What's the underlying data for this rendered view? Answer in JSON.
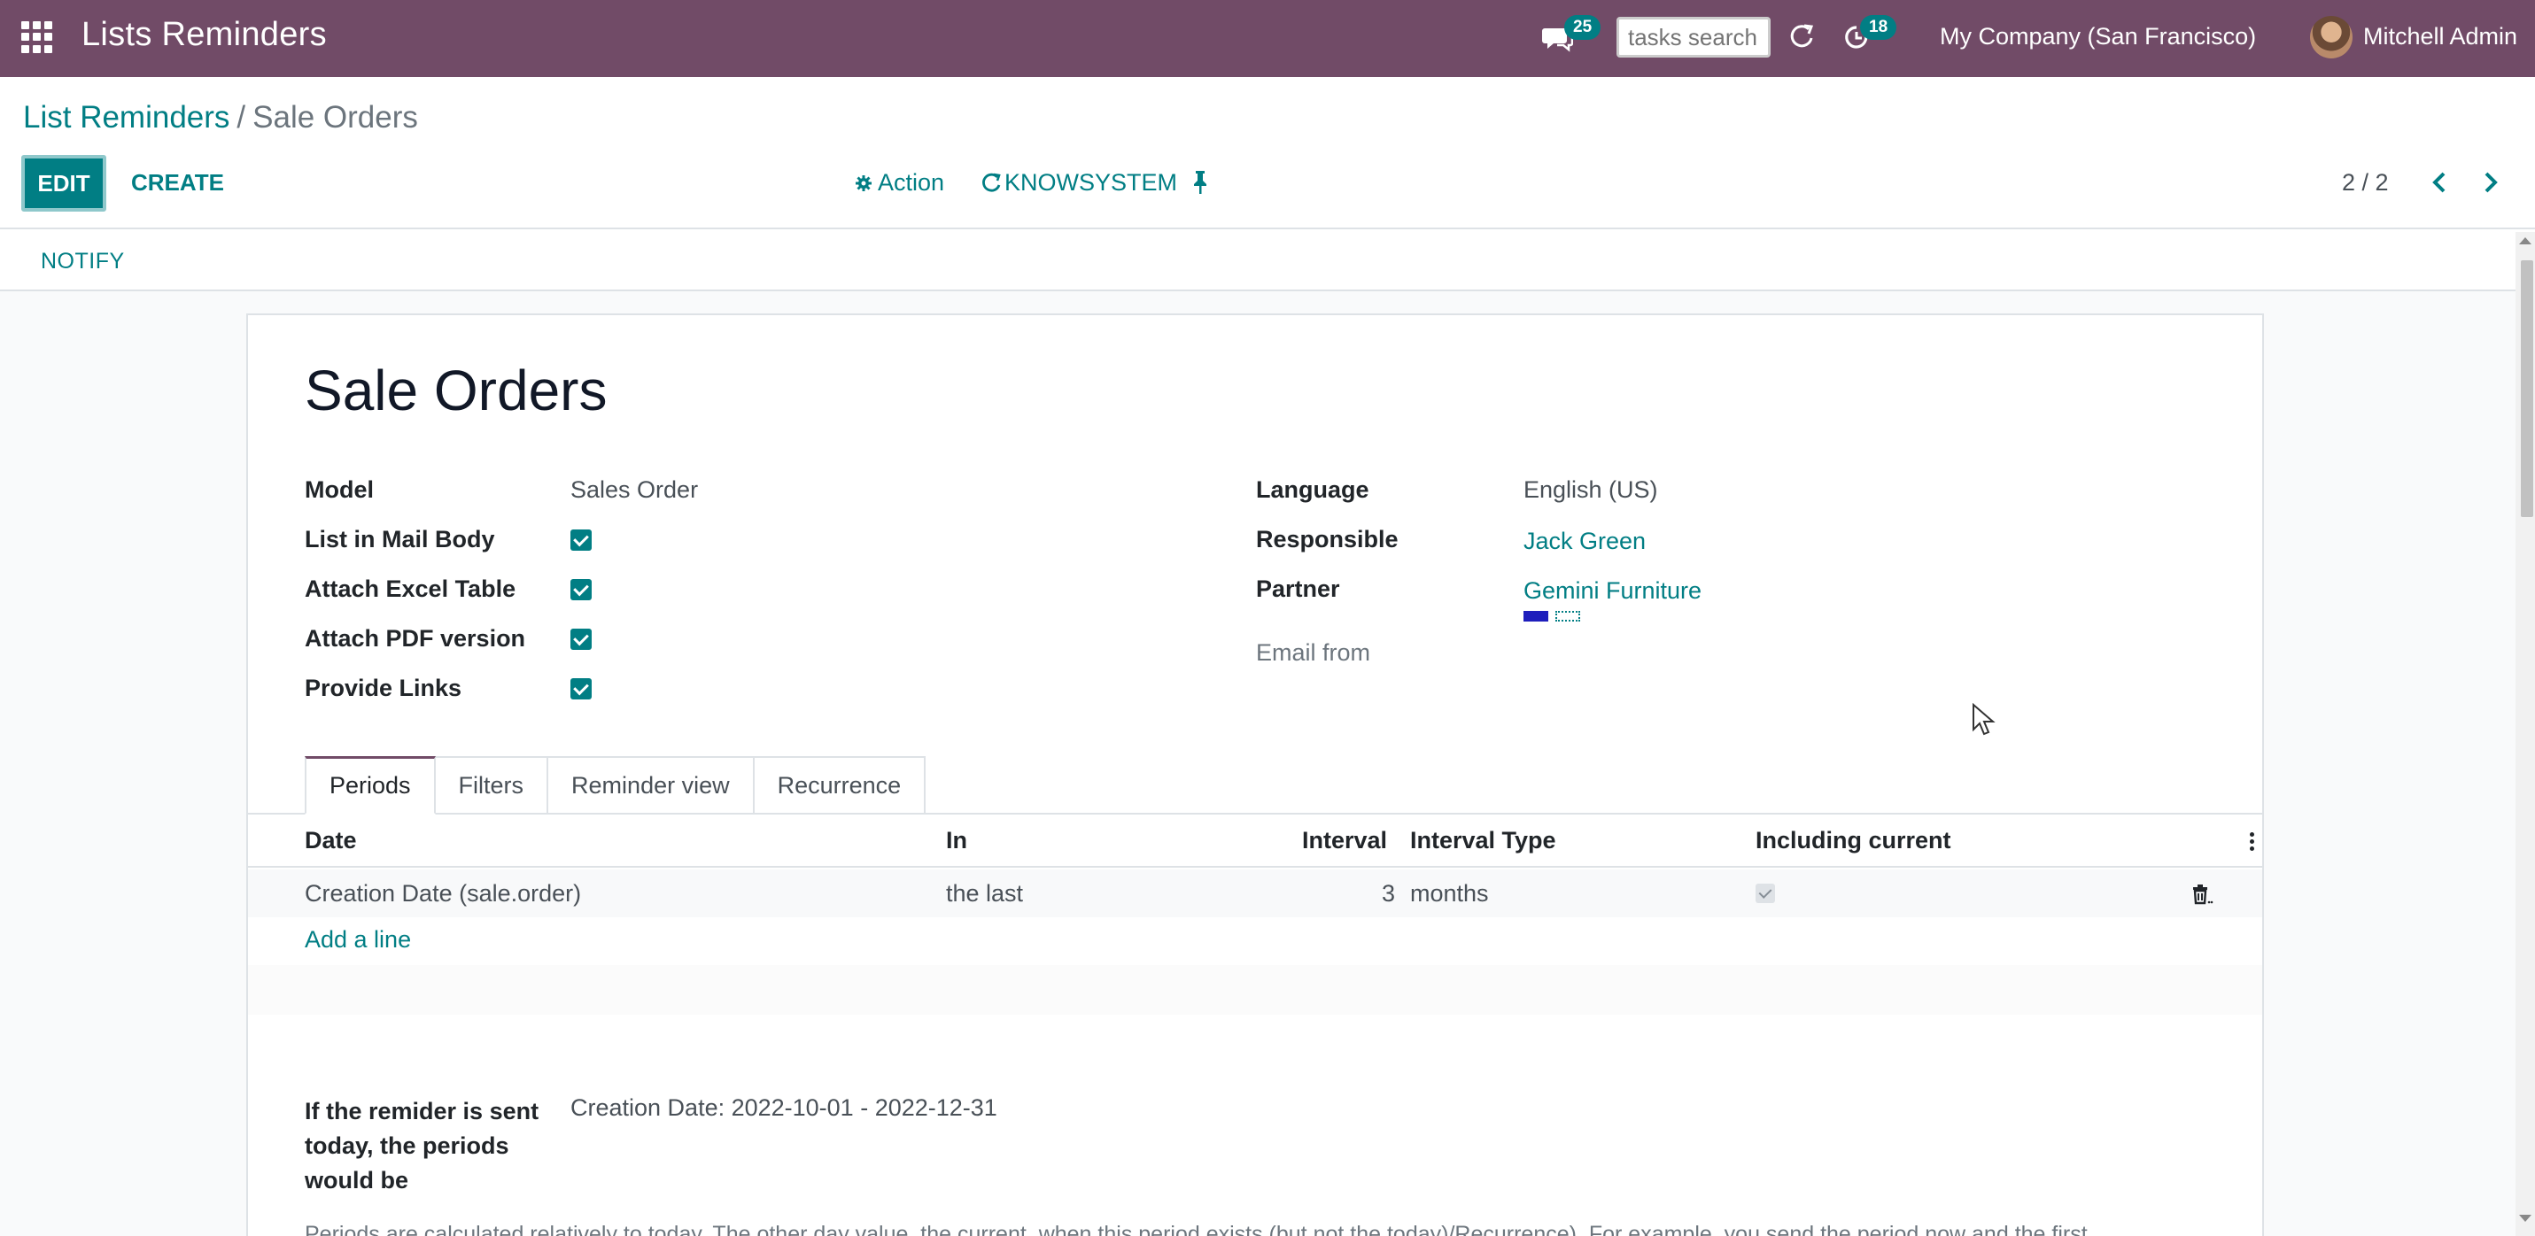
{
  "navbar": {
    "app_title": "Lists Reminders",
    "chat_count": "25",
    "activity_count": "18",
    "search_placeholder": "tasks search",
    "company": "My Company (San Francisco)",
    "user": "Mitchell Admin",
    "bg_color": "#714b67"
  },
  "breadcrumb": {
    "parent": "List Reminders",
    "separator": "/",
    "current": "Sale Orders"
  },
  "toolbar": {
    "edit_label": "EDIT",
    "create_label": "CREATE",
    "action_label": "Action",
    "knowsystem_label": "KNOWSYSTEM",
    "pager": "2 / 2"
  },
  "statusbar": {
    "notify_label": "NOTIFY"
  },
  "form": {
    "title": "Sale Orders",
    "left_fields": [
      {
        "label": "Model",
        "value": "Sales Order"
      },
      {
        "label": "List in Mail Body",
        "checked": true
      },
      {
        "label": "Attach Excel Table",
        "checked": true
      },
      {
        "label": "Attach PDF version",
        "checked": true
      },
      {
        "label": "Provide Links",
        "checked": true
      }
    ],
    "right_fields": [
      {
        "label": "Language",
        "value": "English (US)"
      },
      {
        "label": "Responsible",
        "value": "Jack Green"
      },
      {
        "label": "Partner",
        "value": "Gemini Furniture"
      },
      {
        "label": "Email from",
        "value": ""
      }
    ],
    "tabs": [
      "Periods",
      "Filters",
      "Reminder view",
      "Recurrence"
    ],
    "active_tab": "Periods",
    "table": {
      "columns": [
        "Date",
        "In",
        "Interval",
        "Interval Type",
        "Including current"
      ],
      "rows": [
        {
          "date": "Creation Date (sale.order)",
          "in": "the last",
          "interval": "3",
          "interval_type": "months",
          "including_current": true
        }
      ],
      "add_line": "Add a line"
    },
    "preview": {
      "label": "If the remider is sent today, the periods would be",
      "value": "Creation Date: 2022-10-01 - 2022-12-31"
    },
    "note": "Periods are calculated relatively to today. The other day value, the current, when this period exists (but not the today)/Recurrence). For example, you send the period now and the first..."
  },
  "colors": {
    "accent": "#017e84",
    "brand": "#714b67"
  }
}
